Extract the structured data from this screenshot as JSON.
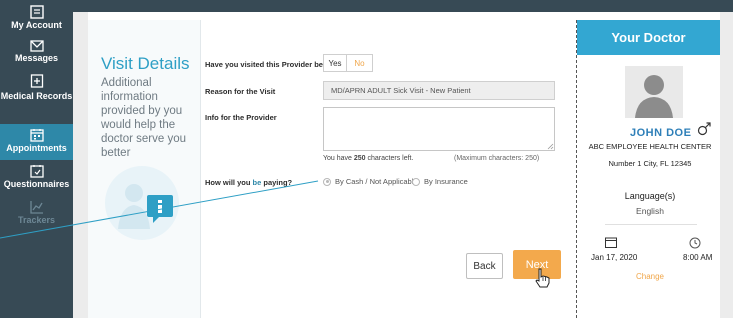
{
  "sidebar": {
    "items": [
      {
        "label": "My Account",
        "icon": "account-icon"
      },
      {
        "label": "Messages",
        "icon": "envelope-icon"
      },
      {
        "label": "Medical Records",
        "icon": "medical-records-icon"
      },
      {
        "label": "Appointments",
        "icon": "calendar-icon",
        "active": true
      },
      {
        "label": "Questionnaires",
        "icon": "questionnaire-icon"
      },
      {
        "label": "Trackers",
        "icon": "chart-icon"
      }
    ]
  },
  "visit": {
    "title": "Visit Details",
    "description": "Additional information provided by you would help the doctor serve you better"
  },
  "form": {
    "visited_question": "Have you visited this Provider before?",
    "yes_label": "Yes",
    "no_label": "No",
    "reason_label": "Reason for the Visit",
    "reason_value": "MD/APRN ADULT Sick Visit - New Patient",
    "info_label": "Info for the Provider",
    "chars_left_prefix": "You have ",
    "chars_left_count": "250",
    "chars_left_suffix": " characters left.",
    "max_chars": "(Maximum characters: 250)",
    "pay_prefix": "How will you ",
    "pay_accent": "be",
    "pay_suffix": " paying?",
    "pay_cash": "By Cash / Not Applicable",
    "pay_insurance": "By Insurance",
    "back_label": "Back",
    "next_label": "Next"
  },
  "doctor": {
    "header": "Your Doctor",
    "name": "JOHN DOE",
    "organization": "ABC EMPLOYEE HEALTH CENTER",
    "address": "Number 1 City, FL 12345",
    "language_label": "Language(s)",
    "language_value": "English",
    "date": "Jan 17, 2020",
    "time": "8:00 AM",
    "change_label": "Change"
  },
  "colors": {
    "sidebar": "#374a55",
    "active": "#2e88a8",
    "accent_blue": "#33a7d2",
    "accent_orange": "#f3a94c"
  }
}
